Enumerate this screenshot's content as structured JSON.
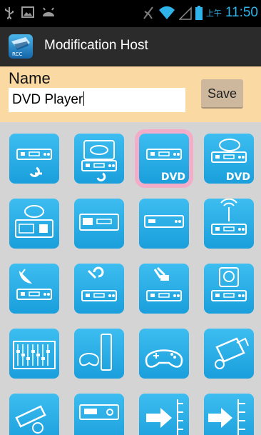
{
  "status_bar": {
    "ampm": "上午",
    "time": "11:50"
  },
  "action_bar": {
    "title": "Modification Host",
    "app_icon": "app-logo-icon",
    "app_icon_text": "RCC"
  },
  "form": {
    "name_label": "Name",
    "name_value": "DVD Player",
    "save_label": "Save"
  },
  "icons": [
    {
      "name": "bluray-player-icon",
      "tag": ""
    },
    {
      "name": "bluray-disc-player-icon",
      "tag": ""
    },
    {
      "name": "dvd-player-icon",
      "tag": "DVD",
      "selected": true
    },
    {
      "name": "dvd-disc-player-icon",
      "tag": "DVD"
    },
    {
      "name": "dvd-recorder-icon",
      "tag": ""
    },
    {
      "name": "media-player-icon",
      "tag": ""
    },
    {
      "name": "set-top-box-icon",
      "tag": ""
    },
    {
      "name": "wireless-receiver-icon",
      "tag": ""
    },
    {
      "name": "satellite-receiver-icon",
      "tag": ""
    },
    {
      "name": "cable-box-icon",
      "tag": ""
    },
    {
      "name": "network-box-icon",
      "tag": ""
    },
    {
      "name": "hdd-recorder-icon",
      "tag": ""
    },
    {
      "name": "audio-mixer-icon",
      "tag": ""
    },
    {
      "name": "game-console-icon",
      "tag": ""
    },
    {
      "name": "gamepad-icon",
      "tag": ""
    },
    {
      "name": "camcorder-icon",
      "tag": ""
    },
    {
      "name": "security-camera-icon",
      "tag": ""
    },
    {
      "name": "av-receiver-icon",
      "tag": ""
    },
    {
      "name": "hdmi-switch-icon",
      "tag": ""
    },
    {
      "name": "hdmi-splitter-icon",
      "tag": ""
    }
  ]
}
